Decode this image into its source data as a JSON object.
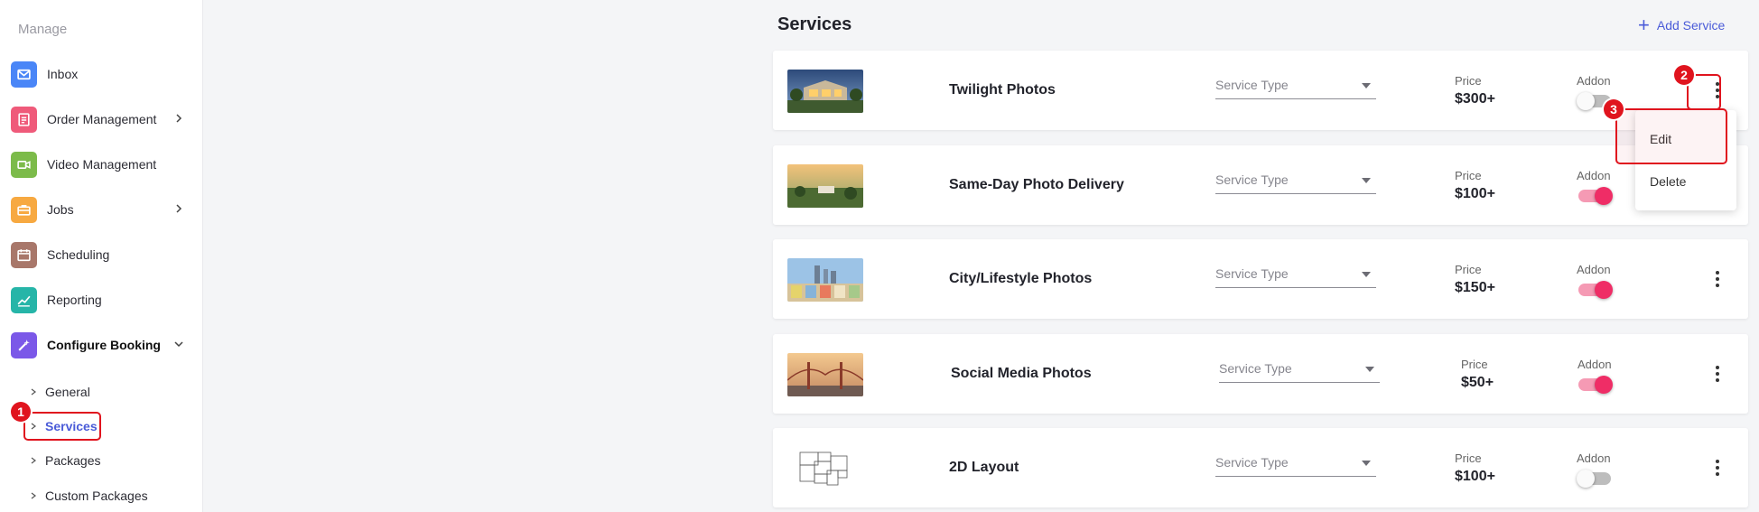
{
  "sidebar": {
    "section_label": "Manage",
    "items": [
      {
        "label": "Inbox",
        "icon": "envelope-icon",
        "color": "#4a86f7"
      },
      {
        "label": "Order Management",
        "icon": "orders-icon",
        "color": "#ef5a7a"
      },
      {
        "label": "Video Management",
        "icon": "video-camera-icon",
        "color": "#7cbb4a"
      },
      {
        "label": "Jobs",
        "icon": "briefcase-icon",
        "color": "#f7a941"
      },
      {
        "label": "Scheduling",
        "icon": "calendar-icon",
        "color": "#a8776a"
      },
      {
        "label": "Reporting",
        "icon": "chart-line-icon",
        "color": "#26b5a8"
      },
      {
        "label": "Configure Booking",
        "icon": "wand-icon",
        "color": "#7b58e8"
      }
    ],
    "sub_items": [
      "General",
      "Services",
      "Packages",
      "Custom Packages"
    ]
  },
  "main": {
    "title": "Services",
    "add_label": "Add Service",
    "price_label": "Price",
    "addon_label": "Addon",
    "service_type_placeholder": "Service Type",
    "services": [
      {
        "name": "Twilight Photos",
        "price": "$300+",
        "addon": false
      },
      {
        "name": "Same-Day Photo Delivery",
        "price": "$100+",
        "addon": true
      },
      {
        "name": "City/Lifestyle Photos",
        "price": "$150+",
        "addon": true
      },
      {
        "name": "Social Media Photos",
        "price": "$50+",
        "addon": true
      },
      {
        "name": "2D Layout",
        "price": "$100+",
        "addon": false
      }
    ],
    "menu": {
      "edit": "Edit",
      "delete": "Delete"
    }
  },
  "annotations": {
    "step1": "1",
    "step2": "2",
    "step3": "3"
  },
  "colors": {
    "accent": "#4a5bd8",
    "highlight": "#e0141e",
    "toggle_on": "#ef2d66"
  }
}
